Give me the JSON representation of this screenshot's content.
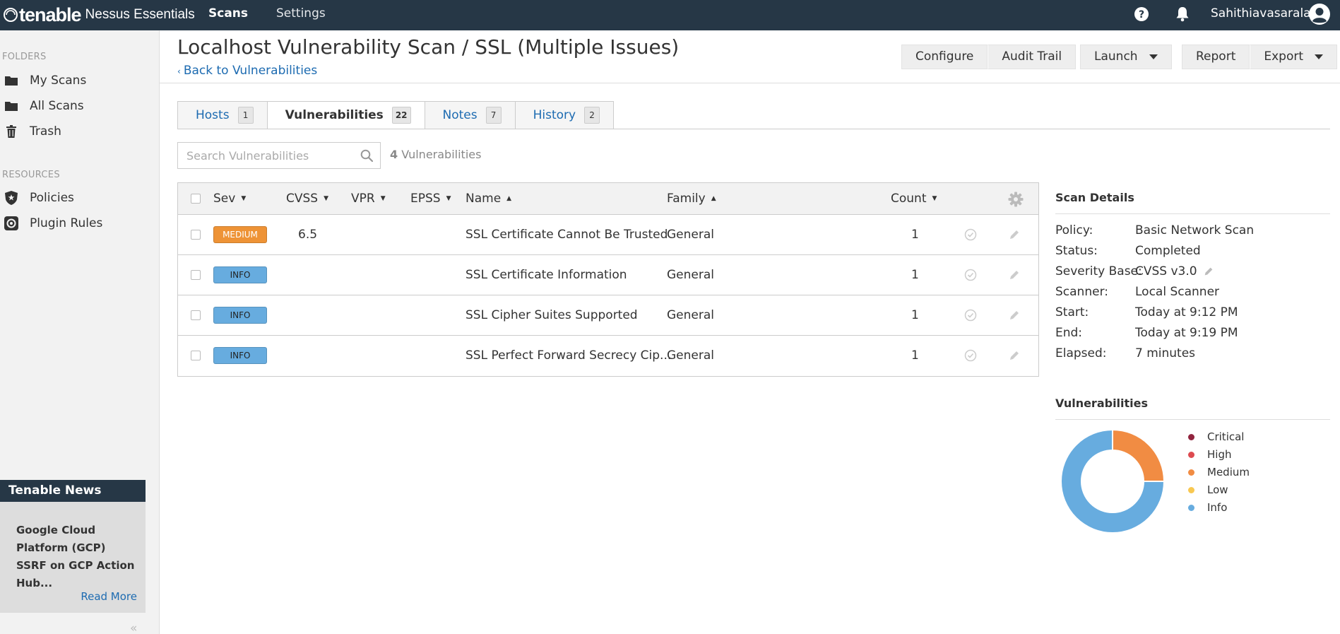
{
  "topbar": {
    "logo_mark": "tenable",
    "logo_product": "Nessus Essentials",
    "nav": {
      "scans": "Scans",
      "settings": "Settings"
    },
    "username": "Sahithiavasarala",
    "icons": [
      "help-icon",
      "bell-icon",
      "user-avatar-icon"
    ]
  },
  "sidebar": {
    "folders_heading": "FOLDERS",
    "folders": [
      {
        "label": "My Scans",
        "icon": "folder-icon"
      },
      {
        "label": "All Scans",
        "icon": "folder-icon"
      },
      {
        "label": "Trash",
        "icon": "trash-icon"
      }
    ],
    "resources_heading": "RESOURCES",
    "resources": [
      {
        "label": "Policies",
        "icon": "policy-shield-icon"
      },
      {
        "label": "Plugin Rules",
        "icon": "plugin-rules-icon"
      }
    ],
    "news": {
      "heading": "Tenable News",
      "headline": "Google Cloud Platform (GCP) SSRF on GCP Action Hub...",
      "read_more": "Read More"
    },
    "collapse_glyph": "«"
  },
  "header": {
    "title": "Localhost Vulnerability Scan / SSL (Multiple Issues)",
    "back_link": "Back to Vulnerabilities",
    "buttons": {
      "configure": "Configure",
      "audit_trail": "Audit Trail",
      "launch": "Launch",
      "report": "Report",
      "export": "Export"
    }
  },
  "tabs": [
    {
      "label": "Hosts",
      "count": "1",
      "active": false
    },
    {
      "label": "Vulnerabilities",
      "count": "22",
      "active": true
    },
    {
      "label": "Notes",
      "count": "7",
      "active": false
    },
    {
      "label": "History",
      "count": "2",
      "active": false
    }
  ],
  "search": {
    "placeholder": "Search Vulnerabilities",
    "value": ""
  },
  "result_count": {
    "number": "4",
    "label": "Vulnerabilities"
  },
  "table": {
    "columns": {
      "sev": "Sev",
      "cvss": "CVSS",
      "vpr": "VPR",
      "epss": "EPSS",
      "name": "Name",
      "family": "Family",
      "count": "Count"
    },
    "rows": [
      {
        "sev": "MEDIUM",
        "cvss": "6.5",
        "vpr": "",
        "epss": "",
        "name": "SSL Certificate Cannot Be Trusted",
        "family": "General",
        "count": "1"
      },
      {
        "sev": "INFO",
        "cvss": "",
        "vpr": "",
        "epss": "",
        "name": "SSL Certificate Information",
        "family": "General",
        "count": "1"
      },
      {
        "sev": "INFO",
        "cvss": "",
        "vpr": "",
        "epss": "",
        "name": "SSL Cipher Suites Supported",
        "family": "General",
        "count": "1"
      },
      {
        "sev": "INFO",
        "cvss": "",
        "vpr": "",
        "epss": "",
        "name": "SSL Perfect Forward Secrecy Cip...",
        "family": "General",
        "count": "1"
      }
    ]
  },
  "scan_details": {
    "heading": "Scan Details",
    "items": [
      {
        "label": "Policy:",
        "value": "Basic Network Scan"
      },
      {
        "label": "Status:",
        "value": "Completed"
      },
      {
        "label": "Severity Base:",
        "value": "CVSS v3.0"
      },
      {
        "label": "Scanner:",
        "value": "Local Scanner"
      },
      {
        "label": "Start:",
        "value": "Today at 9:12 PM"
      },
      {
        "label": "End:",
        "value": "Today at 9:19 PM"
      },
      {
        "label": "Elapsed:",
        "value": "7 minutes"
      }
    ]
  },
  "vulnerabilities_panel": {
    "heading": "Vulnerabilities",
    "legend": [
      {
        "label": "Critical",
        "color": "#91243e"
      },
      {
        "label": "High",
        "color": "#dd4b50"
      },
      {
        "label": "Medium",
        "color": "#f18c43"
      },
      {
        "label": "Low",
        "color": "#f8c851"
      },
      {
        "label": "Info",
        "color": "#67acdf"
      }
    ]
  },
  "chart_data": {
    "type": "pie",
    "categories": [
      "Critical",
      "High",
      "Medium",
      "Low",
      "Info"
    ],
    "values": [
      0,
      0,
      1,
      0,
      3
    ],
    "colors": [
      "#91243e",
      "#dd4b50",
      "#f18c43",
      "#f8c851",
      "#67acdf"
    ],
    "donut": true
  }
}
